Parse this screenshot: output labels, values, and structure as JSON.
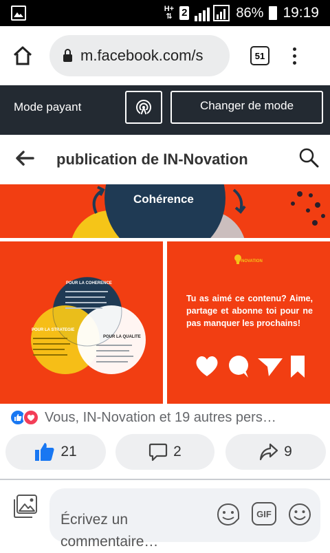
{
  "status_bar": {
    "network_top": "H+",
    "sim_badge": "2",
    "battery_percent": "86%",
    "time": "19:19"
  },
  "browser": {
    "url": "m.facebook.com/s",
    "tab_count": "51"
  },
  "mode_bar": {
    "label": "Mode payant",
    "change_button": "Changer de mode"
  },
  "page_header": {
    "title": "publication de IN-Novation"
  },
  "post": {
    "top_image_heading": "Cohérence",
    "venn": {
      "label_coherence": "POUR LA COHERENCE",
      "label_strategie": "POUR LA STRATEGIE",
      "label_qualite": "POUR LA QUALITE"
    },
    "promo": {
      "brand": "IN-NOVATION",
      "text": "Tu as aimé ce contenu? Aime, partage et abonne toi pour ne pas manquer les prochains!"
    },
    "reactions_text": "Vous, IN-Novation et 19 autres pers…",
    "like_count": "21",
    "comment_count": "2",
    "share_count": "9"
  },
  "comment_bar": {
    "placeholder": "Écrivez un commentaire…",
    "gif_label": "GIF"
  },
  "colors": {
    "brand_orange": "#f23e12",
    "facebook_blue": "#1877f2",
    "mode_bar_bg": "#232a32"
  }
}
